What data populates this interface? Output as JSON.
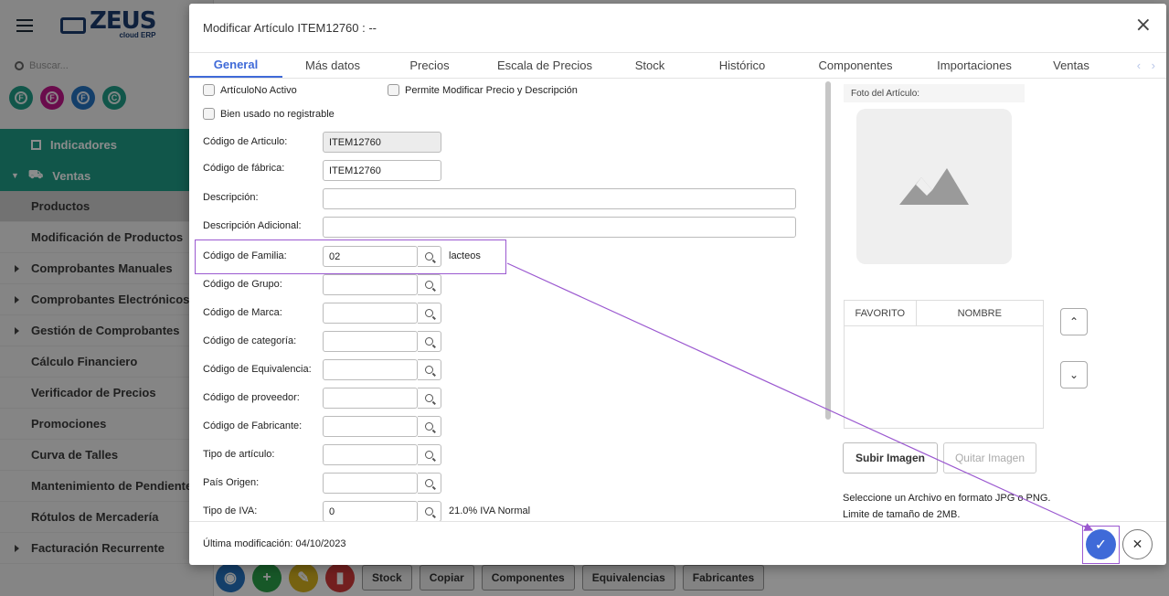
{
  "sidebar": {
    "logo": "ZEUS",
    "logo_sub": "cloud ERP",
    "search_placeholder": "Buscar...",
    "circles": [
      {
        "letter": "F",
        "color": "#1f9d88"
      },
      {
        "letter": "F",
        "color": "#c2168a"
      },
      {
        "letter": "F",
        "color": "#2673c2"
      },
      {
        "letter": "C",
        "color": "#1f9d88"
      }
    ],
    "group_items": [
      "Indicadores",
      "Ventas"
    ],
    "menu": [
      {
        "label": "Productos",
        "active": true,
        "caret": false
      },
      {
        "label": "Modificación de Productos",
        "caret": false
      },
      {
        "label": "Comprobantes Manuales",
        "caret": true
      },
      {
        "label": "Comprobantes Electrónicos",
        "caret": true
      },
      {
        "label": "Gestión de Comprobantes",
        "caret": true
      },
      {
        "label": "Cálculo Financiero",
        "caret": false
      },
      {
        "label": "Verificador de Precios",
        "caret": false
      },
      {
        "label": "Promociones",
        "caret": false
      },
      {
        "label": "Curva de Talles",
        "caret": false
      },
      {
        "label": "Mantenimiento de Pendientes",
        "caret": false
      },
      {
        "label": "Rótulos de Mercadería",
        "caret": false
      },
      {
        "label": "Facturación Recurrente",
        "caret": true
      }
    ]
  },
  "bottom_bar": {
    "buttons": [
      "Stock",
      "Copiar",
      "Componentes",
      "Equivalencias",
      "Fabricantes"
    ]
  },
  "modal": {
    "title": "Modificar Artículo ITEM12760 : --",
    "close_icon": "×",
    "tabs": [
      "General",
      "Más datos",
      "Precios",
      "Escala de Precios",
      "Stock",
      "Histórico",
      "Componentes",
      "Importaciones",
      "Ventas"
    ],
    "active_tab": "General",
    "checkboxes": {
      "no_activo": "ArtículoNo Activo",
      "permite_modificar": "Permite Modificar Precio y Descripción",
      "bien_usado": "Bien usado no registrable"
    },
    "fields": {
      "codigo_articulo": {
        "label": "Código de Articulo:",
        "value": "ITEM12760"
      },
      "codigo_fabrica": {
        "label": "Código de fábrica:",
        "value": "ITEM12760"
      },
      "descripcion": {
        "label": "Descripción:",
        "value": ""
      },
      "descripcion_adicional": {
        "label": "Descripción Adicional:",
        "value": ""
      },
      "codigo_familia": {
        "label": "Código de Familia:",
        "value": "02",
        "desc": "lacteos"
      },
      "codigo_grupo": {
        "label": "Código de Grupo:",
        "value": ""
      },
      "codigo_marca": {
        "label": "Código de Marca:",
        "value": ""
      },
      "codigo_categoria": {
        "label": "Código de categoría:",
        "value": ""
      },
      "codigo_equivalencia": {
        "label": "Código de Equivalencia:",
        "value": ""
      },
      "codigo_proveedor": {
        "label": "Código de proveedor:",
        "value": ""
      },
      "codigo_fabricante": {
        "label": "Código de Fabricante:",
        "value": ""
      },
      "tipo_articulo": {
        "label": "Tipo de artículo:",
        "value": ""
      },
      "pais_origen": {
        "label": "País Origen:",
        "value": ""
      },
      "tipo_iva": {
        "label": "Tipo de IVA:",
        "value": "0",
        "desc": "21.0% IVA Normal"
      }
    },
    "right": {
      "foto_label": "Foto del Artículo:",
      "fav_columns": [
        "FAVORITO",
        "NOMBRE"
      ],
      "subir": "Subir Imagen",
      "quitar": "Quitar Imagen",
      "note1": "Seleccione un Archivo en formato JPG o PNG.",
      "note2": "Limite de tamaño de 2MB."
    },
    "footer": "Última modificación: 04/10/2023"
  },
  "colors": {
    "accent": "#3f6ad8",
    "sidebar_green": "#1f9d88",
    "annotation": "#9b59d0"
  }
}
